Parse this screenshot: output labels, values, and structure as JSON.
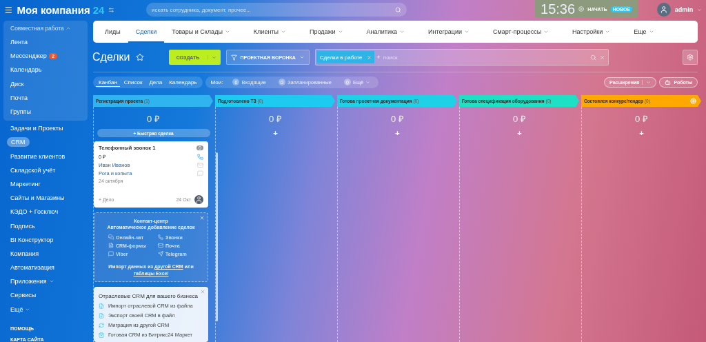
{
  "header": {
    "logo": "Моя компания",
    "logo_suffix": "24",
    "search": {
      "placeholder": "искать сотрудника, документ, прочее..."
    },
    "clock": "15:36",
    "start": "НАЧАТЬ",
    "badge": "НОВОЕ",
    "user": "admin"
  },
  "sidebar": {
    "group": {
      "title": "Совместная работа",
      "expanded": true,
      "items": [
        {
          "label": "Лента",
          "selected": false
        },
        {
          "label": "Мессенджер",
          "selected": false,
          "counter": "2"
        },
        {
          "label": "Календарь",
          "selected": false
        },
        {
          "label": "Диск",
          "selected": false
        },
        {
          "label": "Почта",
          "selected": false
        },
        {
          "label": "Группы",
          "selected": false
        }
      ]
    },
    "items": [
      {
        "label": "Задачи и Проекты",
        "selected": false,
        "caret": false
      },
      {
        "label": "CRM",
        "selected": true,
        "caret": false
      },
      {
        "label": "Развитие клиентов",
        "selected": false,
        "caret": false
      },
      {
        "label": "Складской учёт",
        "selected": false,
        "caret": false
      },
      {
        "label": "Маркетинг",
        "selected": false,
        "caret": false
      },
      {
        "label": "Сайты и Магазины",
        "selected": false,
        "caret": false
      },
      {
        "label": "КЭДО + Госключ",
        "selected": false,
        "caret": false
      },
      {
        "label": "Подпись",
        "selected": false,
        "caret": false
      },
      {
        "label": "BI Конструктор",
        "selected": false,
        "caret": false
      },
      {
        "label": "Компания",
        "selected": false,
        "caret": false
      },
      {
        "label": "Автоматизация",
        "selected": false,
        "caret": false
      },
      {
        "label": "Приложения",
        "selected": false,
        "caret": true
      },
      {
        "label": "Сервисы",
        "selected": false,
        "caret": false
      },
      {
        "label": "Ещё",
        "selected": false,
        "caret": true
      }
    ],
    "footer": [
      "ПОМОЩЬ",
      "КАРТА САЙТА"
    ]
  },
  "nav_tabs": [
    {
      "label": "Лиды",
      "selected": false,
      "dropdown": false
    },
    {
      "label": "Сделки",
      "selected": true,
      "dropdown": false
    },
    {
      "label": "Товары и Склады",
      "selected": false,
      "dropdown": true
    },
    {
      "label": "Клиенты",
      "selected": false,
      "dropdown": true
    },
    {
      "label": "Продажи",
      "selected": false,
      "dropdown": true
    },
    {
      "label": "Аналитика",
      "selected": false,
      "dropdown": true
    },
    {
      "label": "Интеграции",
      "selected": false,
      "dropdown": true
    },
    {
      "label": "Смарт-процессы",
      "selected": false,
      "dropdown": true
    },
    {
      "label": "Настройки",
      "selected": false,
      "dropdown": true
    },
    {
      "label": "Еще",
      "selected": false,
      "dropdown": true
    }
  ],
  "toolbar": {
    "title": "Сделки",
    "create": "СОЗДАТЬ",
    "funnel": "ПРОЕКТНАЯ ВОРОНКА",
    "filter_tag": "Сделки в работе",
    "filter_add": "+",
    "search": {
      "placeholder": "поиск"
    }
  },
  "view_tabs": [
    {
      "label": "Канбан",
      "selected": true
    },
    {
      "label": "Список",
      "selected": false
    },
    {
      "label": "Дела",
      "selected": false
    },
    {
      "label": "Календарь",
      "selected": false
    }
  ],
  "counters": {
    "label": "Мои:",
    "items": [
      {
        "count": "0",
        "label": "Входящие",
        "dropdown": false
      },
      {
        "count": "0",
        "label": "Запланированные",
        "dropdown": false
      },
      {
        "count": "0",
        "label": "Ещё",
        "dropdown": true
      }
    ]
  },
  "right_buttons": {
    "extensions": "Расширения",
    "robots": "Роботы"
  },
  "columns": [
    {
      "name": "Регистрация проекта",
      "count": "(1)",
      "color": "#2fb4f0",
      "sum": "0 ₽",
      "add": "+",
      "add_label": "Быстрая сделка",
      "header_add": false
    },
    {
      "name": "Подготовлено ТЗ",
      "count": "(0)",
      "color": "#1ecbf0",
      "sum": "0 ₽",
      "add": "+",
      "header_add": false
    },
    {
      "name": "Готова проектная документация",
      "count": "(0)",
      "color": "#1fd1e6",
      "sum": "0 ₽",
      "add": "+",
      "header_add": false
    },
    {
      "name": "Готова спецификация оборудования",
      "count": "(0)",
      "color": "#1ee0c4",
      "sum": "0 ₽",
      "add": "+",
      "header_add": false
    },
    {
      "name": "Состоялся конкурс/тендер",
      "count": "(0)",
      "color": "#ffa900",
      "sum": "0 ₽",
      "add": "+",
      "header_add": true
    }
  ],
  "cards": [
    {
      "kind": "deal",
      "title": "Телефонный звонок 1",
      "counter": "0",
      "amount": "0 ₽",
      "contact": "Иван Иванов",
      "company": "Рога и копыта",
      "date": "24 октября",
      "add": "+ Дело",
      "short_date": "24 Окт"
    },
    {
      "kind": "contact_center",
      "title": "Контакт-центр",
      "subtitle": "Автоматическое добавление сделок",
      "channels": [
        "Онлайн-чат",
        "Звонки",
        "CRM-формы",
        "Почта",
        "Viber",
        "Telegram"
      ],
      "import": [
        {
          "kind": "text",
          "text": "Импорт данных из "
        },
        {
          "kind": "link",
          "text": "другой CRM"
        },
        {
          "kind": "text",
          "text": " или "
        },
        {
          "kind": "link",
          "text": "таблицы Excel"
        }
      ]
    },
    {
      "kind": "industry",
      "title": "Отраслевые CRM для вашего бизнеса",
      "items": [
        "Импорт отраслевой CRM из файла",
        "Экспорт своей CRM в файл",
        "Миграция из другой CRM",
        "Готовая CRM из Битрикс24 Маркет"
      ]
    }
  ]
}
